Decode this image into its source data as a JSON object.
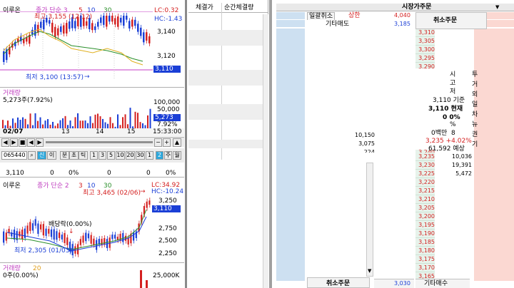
{
  "top_chart": {
    "name": "이루온",
    "indicator": "종가 단순 3",
    "ma_values": [
      "5",
      "10",
      "30"
    ],
    "lc_label": "LC:0.32",
    "hc_label": "HC:-1.43",
    "high_label": "최고 3,155 (12:12)",
    "low_label": "최저 3,100 (13:57)",
    "y_ticks": [
      "3,140",
      "3,120"
    ],
    "current_price": "3,110",
    "volume_title": "거래량",
    "volume_value": "5,273주(7.92%)",
    "volume_ticks": [
      "100,000",
      "50,000"
    ],
    "volume_current": "5,273",
    "volume_pct": "7.92%",
    "date_label": "02/07",
    "x_ticks": [
      "13",
      "14",
      "15"
    ],
    "time_label": "15:33:00"
  },
  "toolbar": {
    "code": "065440",
    "sin_label": "신",
    "i_label": "이",
    "bun_label": "분",
    "cho_label": "초",
    "tick_label": "틱",
    "intervals": [
      "1",
      "3",
      "5",
      "10",
      "20",
      "30",
      "1"
    ],
    "sel_label": "2",
    "ju_label": "주",
    "wol_label": "월"
  },
  "info_row": {
    "price": "3,110",
    "change": "0",
    "change_pct": "0%",
    "val_a": "0",
    "val_b": "0",
    "val_c": "0%"
  },
  "bottom_chart": {
    "name": "이루온",
    "indicator": "종가 단순 2",
    "ma_values": [
      "3",
      "10",
      "30"
    ],
    "lc_label": "LC:34.92",
    "hc_label": "HC:-10.24",
    "high_label": "최고 3,465 (02/06)",
    "low_label": "최저 2,305 (01/03)",
    "dividend_label": "배당락(0.00%)",
    "y_ticks": [
      "3,250",
      "2,750",
      "2,500",
      "2,250"
    ],
    "current_price": "3,110",
    "volume_title": "거래량",
    "volume_ma": "20",
    "volume_value": "0주(0.00%)",
    "volume_tick": "25,000K"
  },
  "trade_panel": {
    "col1": "체결가",
    "col2": "순간체결량"
  },
  "orderbook": {
    "title": "시장가주문",
    "row_cancel_all": "일괄취소",
    "label_upper_limit": "상한",
    "upper_limit_price": "4,040",
    "label_other_sell": "기타매도",
    "other_sell_price": "3,185",
    "cancel_order_top": "취소주문",
    "cancel_order_bottom": "취소주문",
    "sell_prices": [
      "3,310",
      "3,305",
      "3,300",
      "3,295",
      "3,290",
      "3,285",
      "3,280",
      "3,275",
      "3,270",
      "3,265",
      "3,260",
      "3,255",
      "3,250",
      "3,245",
      "3,240"
    ],
    "sell_qty": [
      "",
      "",
      "",
      "",
      "",
      "",
      "",
      "",
      "",
      "",
      "",
      "",
      "10,150",
      "3,075",
      "224"
    ],
    "buy_prices": [
      "3,235",
      "3,230",
      "3,225",
      "3,220",
      "3,215",
      "3,210",
      "3,205",
      "3,200",
      "3,195",
      "3,190",
      "3,185",
      "3,180",
      "3,175",
      "3,170",
      "3,165"
    ],
    "buy_qty": [
      "10,036",
      "19,391",
      "5,472",
      "",
      "",
      "",
      "",
      "",
      "",
      "",
      "",
      "",
      "",
      "",
      ""
    ],
    "bottom_price": "3,030",
    "other_buy_label": "기타매수",
    "info": {
      "l1": "시",
      "l2": "고",
      "l3": "저",
      "l4": "3,110 기준",
      "l5": "3,110 현재",
      "l6": "0 0%",
      "l7": "%",
      "l8a": "0백만",
      "l8b": "8",
      "l9": "3,235 +4.02%",
      "l10": "61,592 예상"
    },
    "side_tabs": [
      "투",
      "거",
      "외",
      "일",
      "차",
      "뉴",
      "권",
      "기"
    ]
  }
}
